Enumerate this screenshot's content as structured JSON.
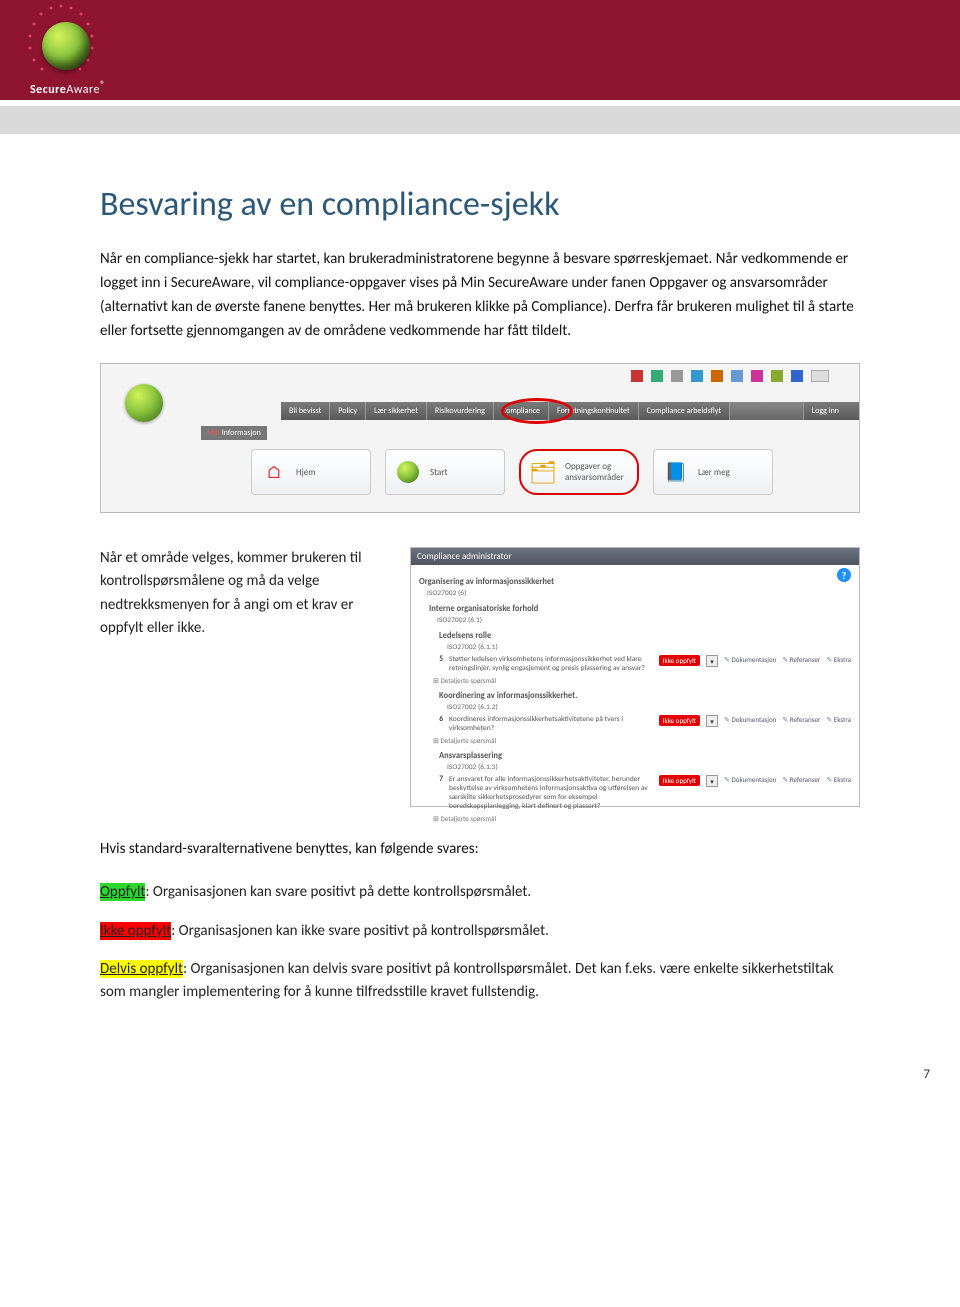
{
  "logo_text_1": "Secure",
  "logo_text_2": "Aware",
  "page_title": "Besvaring av en compliance-sjekk",
  "intro_para": "Når en compliance-sjekk har startet, kan brukeradministratorene begynne å besvare spørreskjemaet. Når vedkommende er logget inn i SecureAware, vil compliance-oppgaver vises på Min SecureAware under fanen Oppgaver og ansvarsområder (alternativt kan de øverste fanene benyttes. Her må brukeren klikke på Compliance). Derfra får brukeren mulighet til å starte eller fortsette gjennomgangen av de områdene vedkommende har fått tildelt.",
  "shot1": {
    "tabs": [
      "Bli bevisst",
      "Policy",
      "Lær sikkerhet",
      "Risikovurdering",
      "Compliance",
      "Forretningskontinuitet",
      "Compliance arbeidsflyt"
    ],
    "login_tab": "Logg inn",
    "infobar_prefix": "Min ",
    "infobar_rest": "Informasjon",
    "cards": {
      "home": "Hjem",
      "start": "Start",
      "oppg_line1": "Oppgaver og",
      "oppg_line2": "ansvarsområder",
      "lear": "Lær meg"
    }
  },
  "twocol_text": "Når et område velges, kommer brukeren til kontrollspørsmålene og må da velge nedtrekksmenyen for å angi om et krav er oppfylt eller ikke.",
  "panel": {
    "title": "Compliance administrator",
    "lvl1": "Organisering av informasjonssikkerhet",
    "lvl1_ref": "ISO27002 (6)",
    "lvl2": "Interne organisatoriske forhold",
    "lvl2_ref": "ISO27002 (6.1)",
    "lvl3a": "Ledelsens rolle",
    "lvl3a_ref": "ISO27002 (6.1.1)",
    "q5_num": "5",
    "q5": "Støtter ledelsen virksomhetens informasjonssikkerhet ved klare retningslinjer, synlig engasjement og presis plassering av ansvar?",
    "lvl3b": "Koordinering av informasjonssikkerhet.",
    "lvl3b_ref": "ISO27002 (6.1.2)",
    "q6_num": "6",
    "q6": "Koordineres informasjonssikkerhetsaktivitetene på tvers i virksomheten?",
    "lvl3c": "Ansvarsplassering",
    "lvl3c_ref": "ISO27002 (6.1.3)",
    "q7_num": "7",
    "q7": "Er ansvaret for alle informasjonssikkerhetsaktiviteter, herunder beskyttelse av virksomhetens informasjonsaktiva og utførelsen av særskilte sikkerhetsprosedyrer som for eksempel beredskapsplanlegging, klart definert og plassert?",
    "chip": "Ikke oppfylt",
    "link_doc": "Dokumentasjon",
    "link_ref": "Referanser",
    "link_ext": "Ekstra",
    "det": "Detaljerte spørsmål"
  },
  "followup_line": "Hvis standard-svaralternativene benyttes, kan følgende svares:",
  "ans1_label": "Oppfylt",
  "ans1_rest": ": Organisasjonen kan svare positivt på dette kontrollspørsmålet.",
  "ans2_label": "Ikke oppfylt",
  "ans2_rest": ": Organisasjonen kan ikke svare positivt på kontrollspørsmålet.",
  "ans3_label": "Delvis oppfylt",
  "ans3_rest": ": Organisasjonen kan delvis svare positivt på kontrollspørsmålet. Det kan f.eks. være enkelte sikkerhetstiltak som mangler implementering for å kunne tilfredsstille kravet fullstendig.",
  "page_number": "7"
}
